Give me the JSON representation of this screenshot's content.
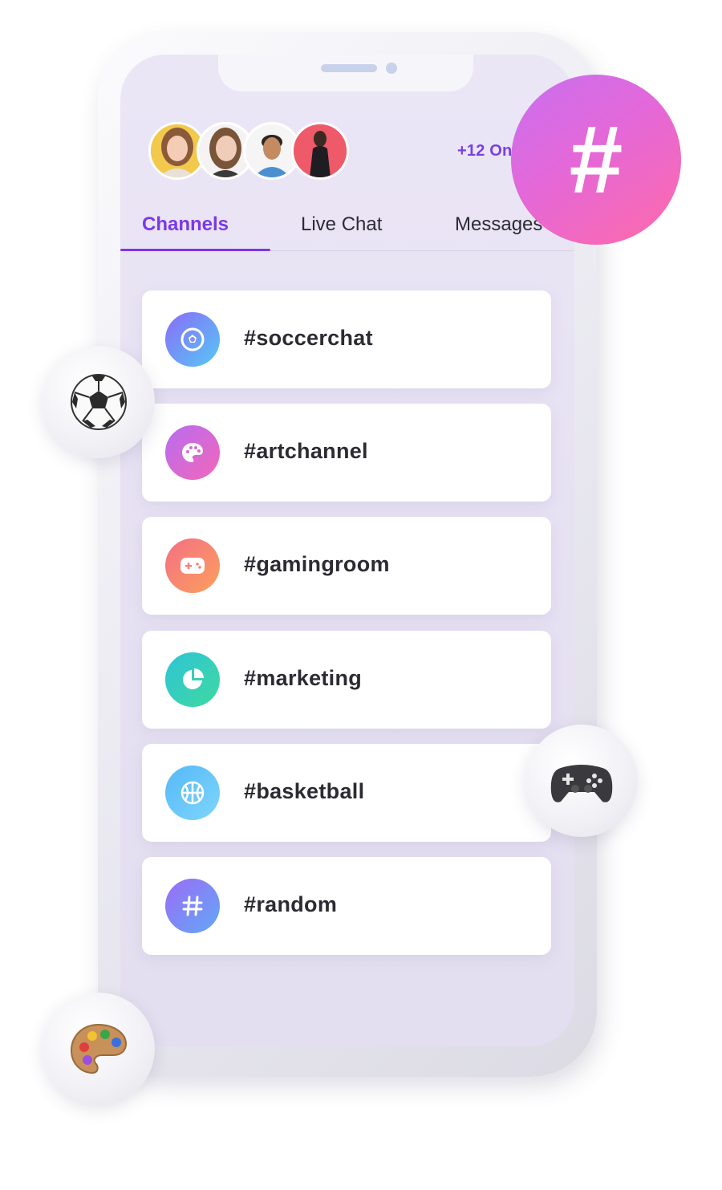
{
  "header": {
    "online_text": "+12 Online",
    "avatars": [
      {
        "name": "avatar-1",
        "bg": "#f2c94c"
      },
      {
        "name": "avatar-2",
        "bg": "#ffffff"
      },
      {
        "name": "avatar-3",
        "bg": "#ffffff"
      },
      {
        "name": "avatar-4",
        "bg": "#ef5a6a"
      }
    ]
  },
  "tabs": [
    {
      "label": "Channels",
      "active": true
    },
    {
      "label": "Live Chat",
      "active": false
    },
    {
      "label": "Messages",
      "active": false
    }
  ],
  "channels": [
    {
      "label": "#soccerchat",
      "icon": "soccer-ball-icon",
      "colors": [
        "#8a6cf8",
        "#55c8f5"
      ]
    },
    {
      "label": "#artchannel",
      "icon": "palette-icon",
      "colors": [
        "#b86cf2",
        "#f267b8"
      ]
    },
    {
      "label": "#gamingroom",
      "icon": "gamepad-icon",
      "colors": [
        "#f46f86",
        "#fba05a"
      ]
    },
    {
      "label": "#marketing",
      "icon": "pie-chart-icon",
      "colors": [
        "#2ec4d6",
        "#3fd9a0"
      ]
    },
    {
      "label": "#basketball",
      "icon": "basketball-icon",
      "colors": [
        "#55b8f8",
        "#7fd6fa"
      ]
    },
    {
      "label": "#random",
      "icon": "hash-icon",
      "colors": [
        "#9b6cf6",
        "#62a8f6"
      ]
    }
  ],
  "decorations": {
    "hash_badge": "#",
    "floating_icons": [
      "soccer-ball-emoji",
      "game-controller-emoji",
      "artist-palette-emoji"
    ]
  },
  "colors": {
    "accent": "#7a38e8",
    "screen_bg": "#ebe6f6"
  }
}
